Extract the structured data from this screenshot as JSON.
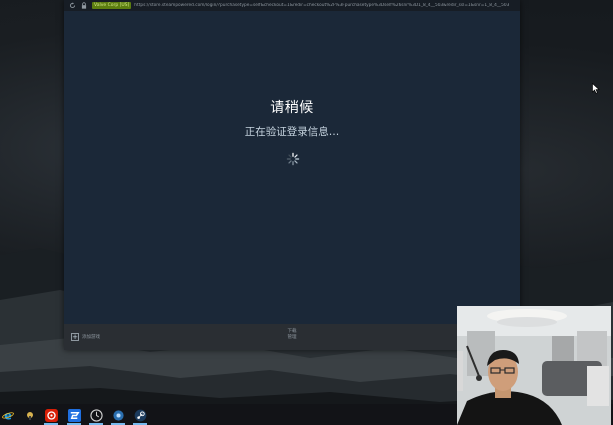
{
  "browser": {
    "cert_badge": "Valve Corp [US]",
    "url": "https://store.steampowered.com/login/?purchasetype=self&checkout=1&redir=checkout%2F%3Fpurchasetype%3Dself%26snr%3D1_8_4__503&redir_ssl=1&snr=1_8_4__503",
    "refresh_icon": "refresh-icon",
    "lock_icon": "lock-icon"
  },
  "page": {
    "title": "请稍候",
    "subtitle": "正在验证登录信息…",
    "spinner_icon": "loading-spinner-icon"
  },
  "bottom_bar": {
    "add_game_label": "添加游戏",
    "downloads_label_line1": "下载",
    "downloads_label_line2": "管理",
    "add_icon": "plus-icon"
  },
  "taskbar": {
    "icons": [
      {
        "name": "ie-browser-icon",
        "active": false
      },
      {
        "name": "app-icon",
        "active": false
      },
      {
        "name": "netease-music-icon",
        "active": true
      },
      {
        "name": "game-launcher-icon",
        "active": true
      },
      {
        "name": "clock-app-icon",
        "active": true
      },
      {
        "name": "settings-app-icon",
        "active": true
      },
      {
        "name": "steam-icon",
        "active": true
      }
    ]
  },
  "colors": {
    "steam_bg": "#1b2838",
    "urlbar_bg": "#171d25",
    "badge_bg": "#5c7e10",
    "bottom_bar_bg": "#2a2e33",
    "taskbar_accent": "#76b9ed"
  },
  "webcam": {
    "description_icon": "webcam-overlay"
  }
}
